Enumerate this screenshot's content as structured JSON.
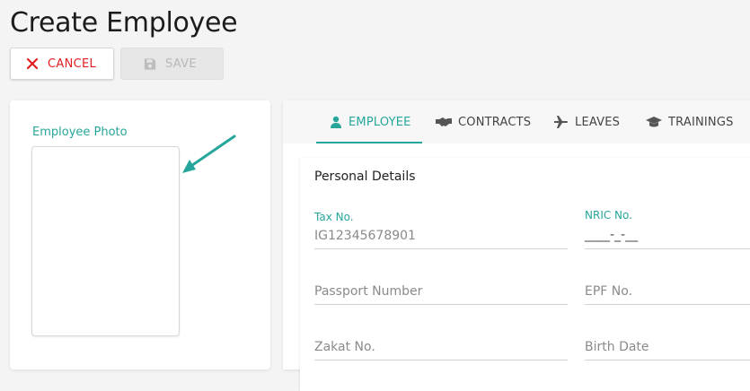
{
  "page": {
    "title": "Create Employee"
  },
  "toolbar": {
    "cancel_label": "CANCEL",
    "save_label": "SAVE",
    "cancel_color": "#e02020",
    "save_disabled": true
  },
  "photo": {
    "label": "Employee Photo"
  },
  "tabs": [
    {
      "label": "EMPLOYEE",
      "icon": "person-icon",
      "active": true
    },
    {
      "label": "CONTRACTS",
      "icon": "handshake-icon",
      "active": false
    },
    {
      "label": "LEAVES",
      "icon": "airplane-icon",
      "active": false
    },
    {
      "label": "TRAININGS",
      "icon": "graduation-cap-icon",
      "active": false
    }
  ],
  "form": {
    "section_title": "Personal Details",
    "tax_no": {
      "label": "Tax No.",
      "value": "IG12345678901"
    },
    "nric_no": {
      "label": "NRIC No.",
      "value": "____-_-__"
    },
    "passport_number": {
      "placeholder": "Passport Number"
    },
    "epf_no": {
      "placeholder": "EPF No."
    },
    "zakat_no": {
      "placeholder": "Zakat No."
    },
    "birth_date": {
      "placeholder": "Birth Date"
    }
  },
  "colors": {
    "accent": "#26a69a",
    "danger": "#e02020"
  }
}
